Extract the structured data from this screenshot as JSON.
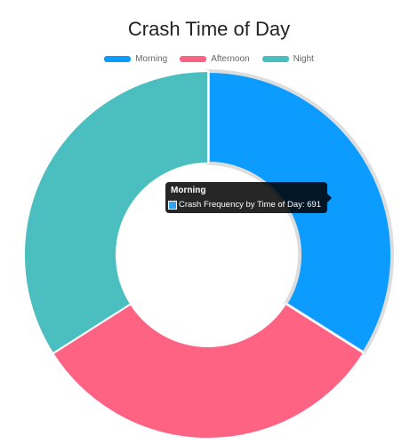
{
  "chart_data": {
    "type": "pie",
    "variant": "doughnut",
    "title": "Crash Time of Day",
    "legend_position": "top",
    "series": [
      {
        "name": "Crash Frequency by Time of Day",
        "categories": [
          "Morning",
          "Afternoon",
          "Night"
        ],
        "values": [
          691,
          651,
          692
        ],
        "colors": [
          "#0c9bff",
          "#ff6384",
          "#4bbfbf"
        ]
      }
    ]
  },
  "tooltip": {
    "title": "Morning",
    "label": "Crash Frequency by Time of Day: 691",
    "color": "#36a2eb"
  }
}
